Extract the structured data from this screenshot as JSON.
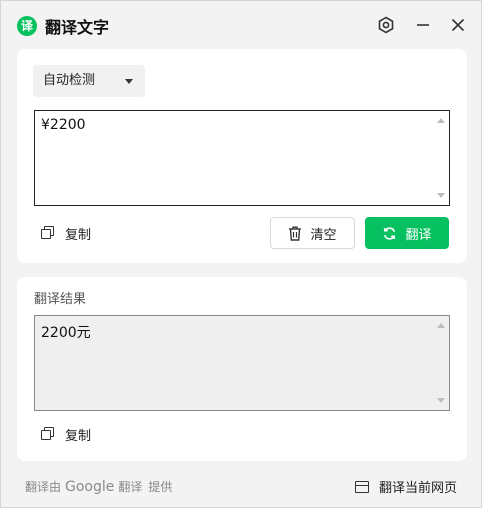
{
  "app": {
    "logo_char": "译",
    "title": "翻译文字"
  },
  "source": {
    "language": "自动检测",
    "text": "¥2200",
    "copy_label": "复制",
    "clear_label": "清空",
    "translate_label": "翻译"
  },
  "result": {
    "label": "翻译结果",
    "text": "2200元",
    "copy_label": "复制"
  },
  "footer": {
    "prefix": "翻译由",
    "brand": "Google",
    "brand_suffix": "翻译",
    "suffix": "提供",
    "translate_page_label": "翻译当前网页"
  },
  "colors": {
    "accent": "#07c160",
    "window_bg": "#f3f3f3",
    "card_bg": "#ffffff"
  }
}
